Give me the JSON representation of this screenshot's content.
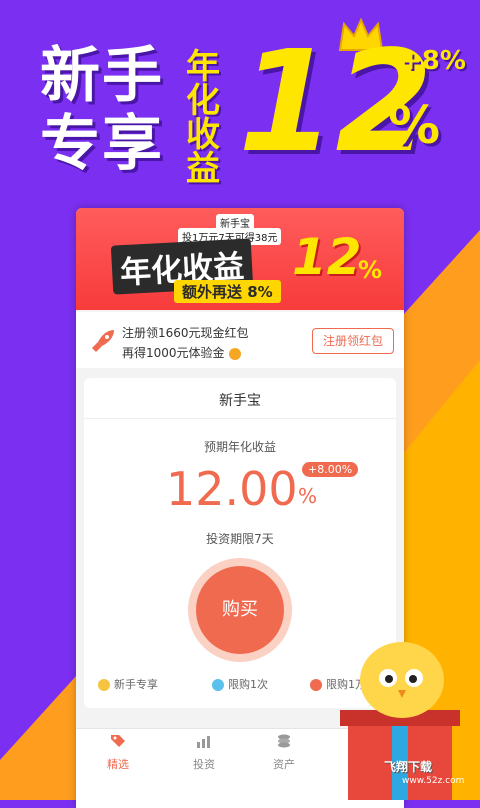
{
  "hero": {
    "title_line1": "新手",
    "title_line2": "专享",
    "subtitle": "年化收益",
    "rate": "12",
    "rate_unit": "%",
    "bonus": "+8%"
  },
  "banner": {
    "top_badge": "新手宝",
    "top_text": "投1万元7天可得38元",
    "main": "年化收益",
    "sub": "额外再送 8%",
    "rate": "12",
    "rate_unit": "%"
  },
  "promo": {
    "line1": "注册领1660元现金红包",
    "line2": "再得1000元体验金",
    "button": "注册领红包"
  },
  "product": {
    "name": "新手宝",
    "rate_label": "预期年化收益",
    "rate_value": "12.00",
    "rate_unit": "%",
    "bonus_badge": "+8.00%",
    "term": "投资期限7天",
    "buy_label": "购买",
    "features": [
      "新手专享",
      "限购1次",
      "限购1万"
    ]
  },
  "tabs": [
    {
      "label": "精选",
      "icon": "tag-icon",
      "active": true
    },
    {
      "label": "投资",
      "icon": "chart-icon",
      "active": false
    },
    {
      "label": "资产",
      "icon": "coins-icon",
      "active": false
    }
  ],
  "watermark": {
    "text": "飞翔下载",
    "url": "www.52z.com"
  },
  "colors": {
    "accent": "#f06a4f",
    "brand_purple": "#7b2ff0",
    "brand_yellow": "#ffe600",
    "bg_orange": "#ff9d1e"
  }
}
